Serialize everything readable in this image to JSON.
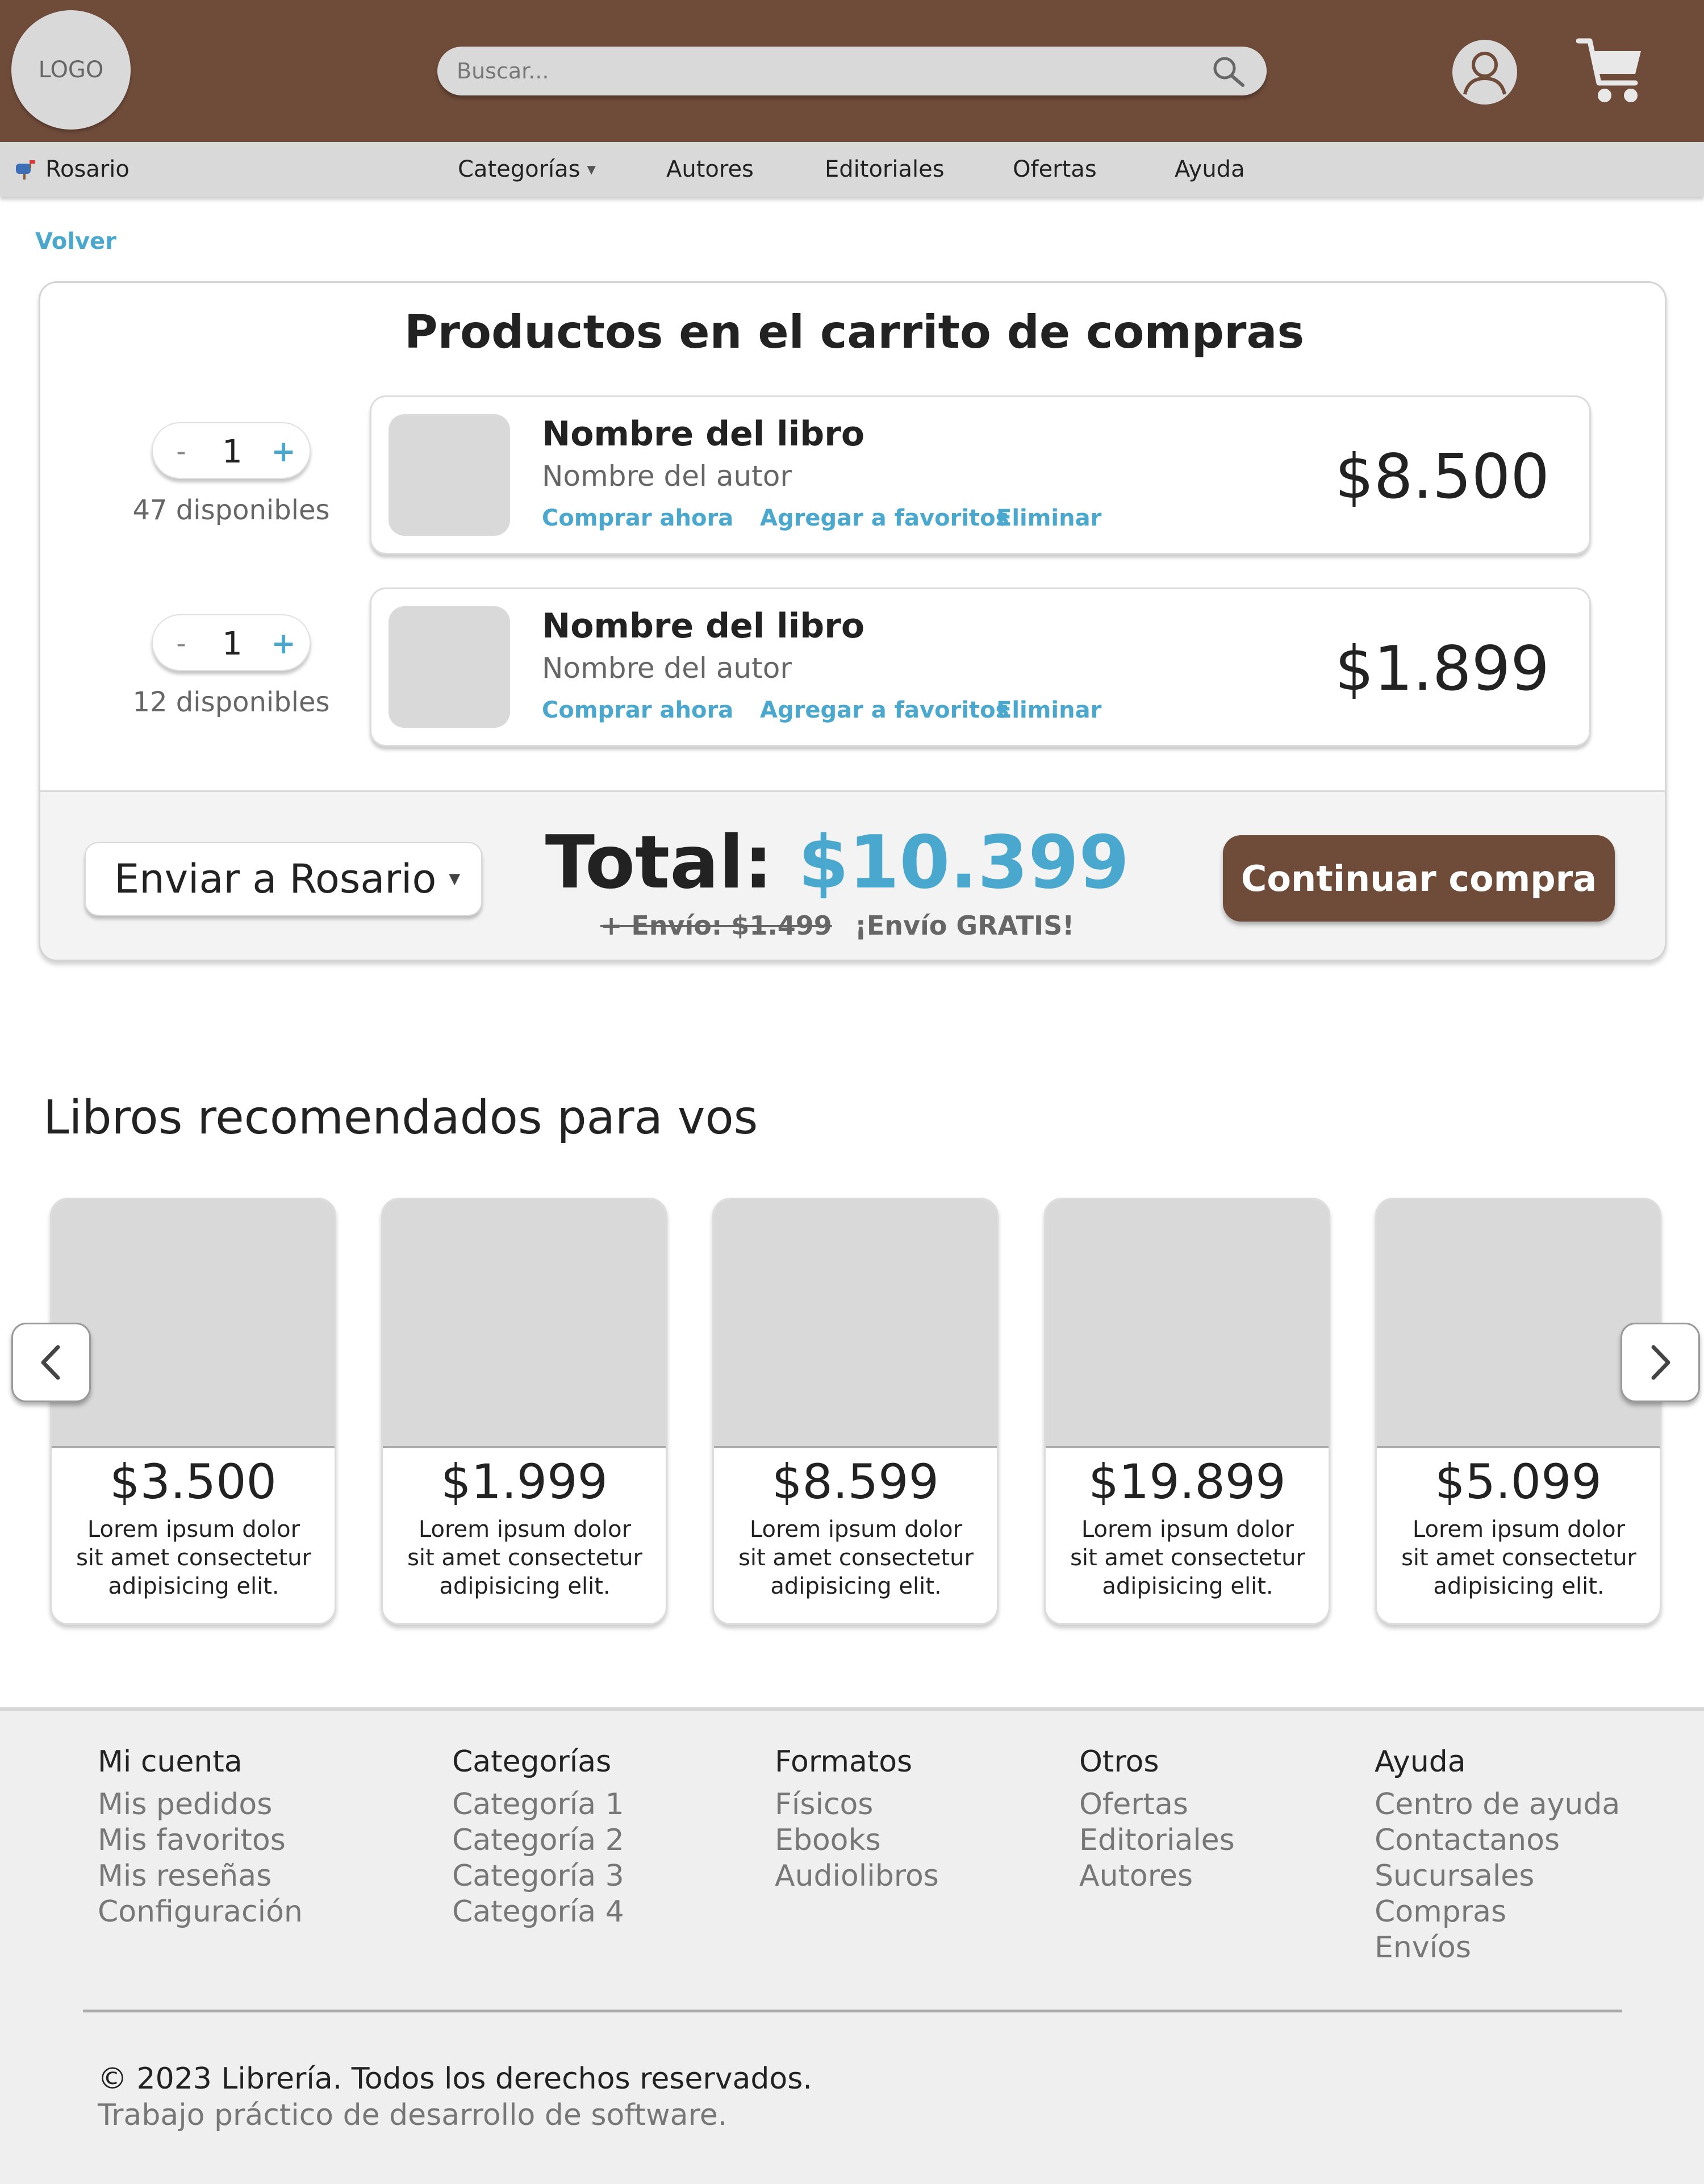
{
  "header": {
    "logo_text": "LOGO",
    "search_placeholder": "Buscar..."
  },
  "nav": {
    "location": "Rosario",
    "items": [
      "Categorías",
      "Autores",
      "Editoriales",
      "Ofertas",
      "Ayuda"
    ]
  },
  "back_label": "Volver",
  "cart": {
    "title": "Productos en el carrito de compras",
    "items": [
      {
        "quantity": "1",
        "available": "47 disponibles",
        "title": "Nombre del libro",
        "author": "Nombre del autor",
        "buy": "Comprar ahora",
        "fav": "Agregar a favoritos",
        "remove": "Eliminar",
        "price": "$8.500"
      },
      {
        "quantity": "1",
        "available": "12 disponibles",
        "title": "Nombre del libro",
        "author": "Nombre del autor",
        "buy": "Comprar ahora",
        "fav": "Agregar a favoritos",
        "remove": "Eliminar",
        "price": "$1.899"
      }
    ],
    "minus": "-",
    "plus": "+",
    "ship_to": "Enviar a Rosario",
    "total_label": "Total:",
    "total_value": "$10.399",
    "shipping_old": "+ Envío: $1.499",
    "shipping_free": "¡Envío GRATIS!",
    "continue_label": "Continuar compra"
  },
  "recommended": {
    "title": "Libros recomendados para vos",
    "items": [
      {
        "price": "$3.500",
        "desc": "Lorem ipsum dolor sit amet consectetur adipisicing elit."
      },
      {
        "price": "$1.999",
        "desc": "Lorem ipsum dolor sit amet consectetur adipisicing elit."
      },
      {
        "price": "$8.599",
        "desc": "Lorem ipsum dolor sit amet consectetur adipisicing elit."
      },
      {
        "price": "$19.899",
        "desc": "Lorem ipsum dolor sit amet consectetur adipisicing elit."
      },
      {
        "price": "$5.099",
        "desc": "Lorem ipsum dolor sit amet consectetur adipisicing elit."
      }
    ]
  },
  "footer": {
    "columns": [
      {
        "heading": "Mi cuenta",
        "links": [
          "Mis pedidos",
          "Mis favoritos",
          "Mis reseñas",
          "Configuración"
        ]
      },
      {
        "heading": "Categorías",
        "links": [
          "Categoría 1",
          "Categoría 2",
          "Categoría 3",
          "Categoría 4"
        ]
      },
      {
        "heading": "Formatos",
        "links": [
          "Físicos",
          "Ebooks",
          "Audiolibros"
        ]
      },
      {
        "heading": "Otros",
        "links": [
          "Ofertas",
          "Editoriales",
          "Autores"
        ]
      },
      {
        "heading": "Ayuda",
        "links": [
          "Centro de ayuda",
          "Contactanos",
          "Sucursales",
          "Compras",
          "Envíos"
        ]
      }
    ],
    "copyright": "© 2023 Librería. Todos los derechos reservados.",
    "subtitle": "Trabajo práctico de desarrollo de software."
  },
  "icons": {
    "search": "search-icon",
    "user": "user-icon",
    "cart": "cart-icon",
    "location": "mailbox-icon",
    "prev": "chevron-left-icon",
    "next": "chevron-right-icon"
  },
  "colors": {
    "brand_brown": "#6f4b3a",
    "accent_blue": "#4aa8cf",
    "gray_bg": "#d9d9d9"
  }
}
